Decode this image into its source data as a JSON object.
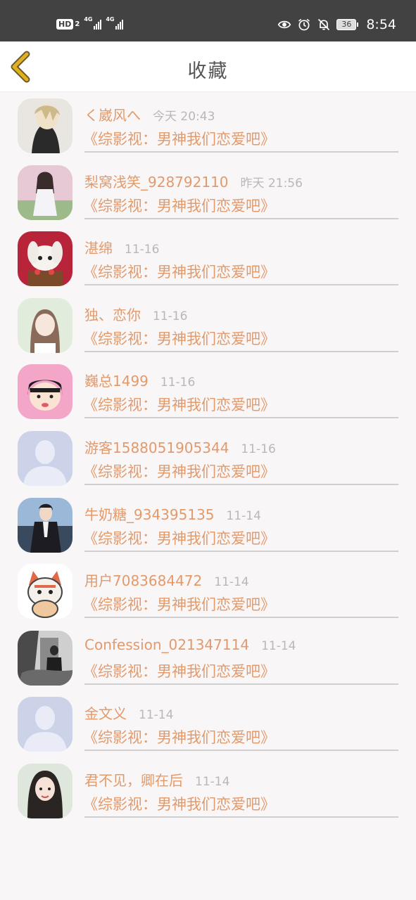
{
  "status_bar": {
    "hd_label": "HD",
    "hd_sub": "2",
    "signal1_label": "4G",
    "signal2_label": "4G",
    "battery": "36",
    "time": "8:54"
  },
  "header": {
    "title": "收藏",
    "accent_color": "#e0b020"
  },
  "list": {
    "items": [
      {
        "name": "く崴风へ",
        "time": "今天 20:43",
        "book": "《综影视：男神我们恋爱吧》",
        "avatar": "anime-portrait"
      },
      {
        "name": "梨窝浅笑_928792110",
        "time": "昨天 21:56",
        "book": "《综影视：男神我们恋爱吧》",
        "avatar": "girl-photo"
      },
      {
        "name": "湛绵",
        "time": "11-16",
        "book": "《综影视：男神我们恋爱吧》",
        "avatar": "rabbit-photo"
      },
      {
        "name": "独、恋你",
        "time": "11-16",
        "book": "《综影视：男神我们恋爱吧》",
        "avatar": "girl-soft-photo"
      },
      {
        "name": "巍总1499",
        "time": "11-16",
        "book": "《综影视：男神我们恋爱吧》",
        "avatar": "cartoon-girl"
      },
      {
        "name": "游客1588051905344",
        "time": "11-16",
        "book": "《综影视：男神我们恋爱吧》",
        "avatar": "default-user"
      },
      {
        "name": "牛奶糖_934395135",
        "time": "11-14",
        "book": "《综影视：男神我们恋爱吧》",
        "avatar": "man-suit-photo"
      },
      {
        "name": "用户7083684472",
        "time": "11-14",
        "book": "《综影视：男神我们恋爱吧》",
        "avatar": "cartoon-cat"
      },
      {
        "name": "Confession_021347114",
        "time": "11-14",
        "book": "《综影视：男神我们恋爱吧》",
        "avatar": "bw-photo"
      },
      {
        "name": "金文义",
        "time": "11-14",
        "book": "《综影视：男神我们恋爱吧》",
        "avatar": "default-user"
      },
      {
        "name": "君不见，卿在后",
        "time": "11-14",
        "book": "《综影视：男神我们恋爱吧》",
        "avatar": "girl-selfie"
      }
    ]
  },
  "colors": {
    "name": "#e39a6b",
    "time": "#b8b8b8",
    "separator": "#cfcfcf",
    "status_bar": "#424242",
    "background": "#f8f6f7"
  }
}
